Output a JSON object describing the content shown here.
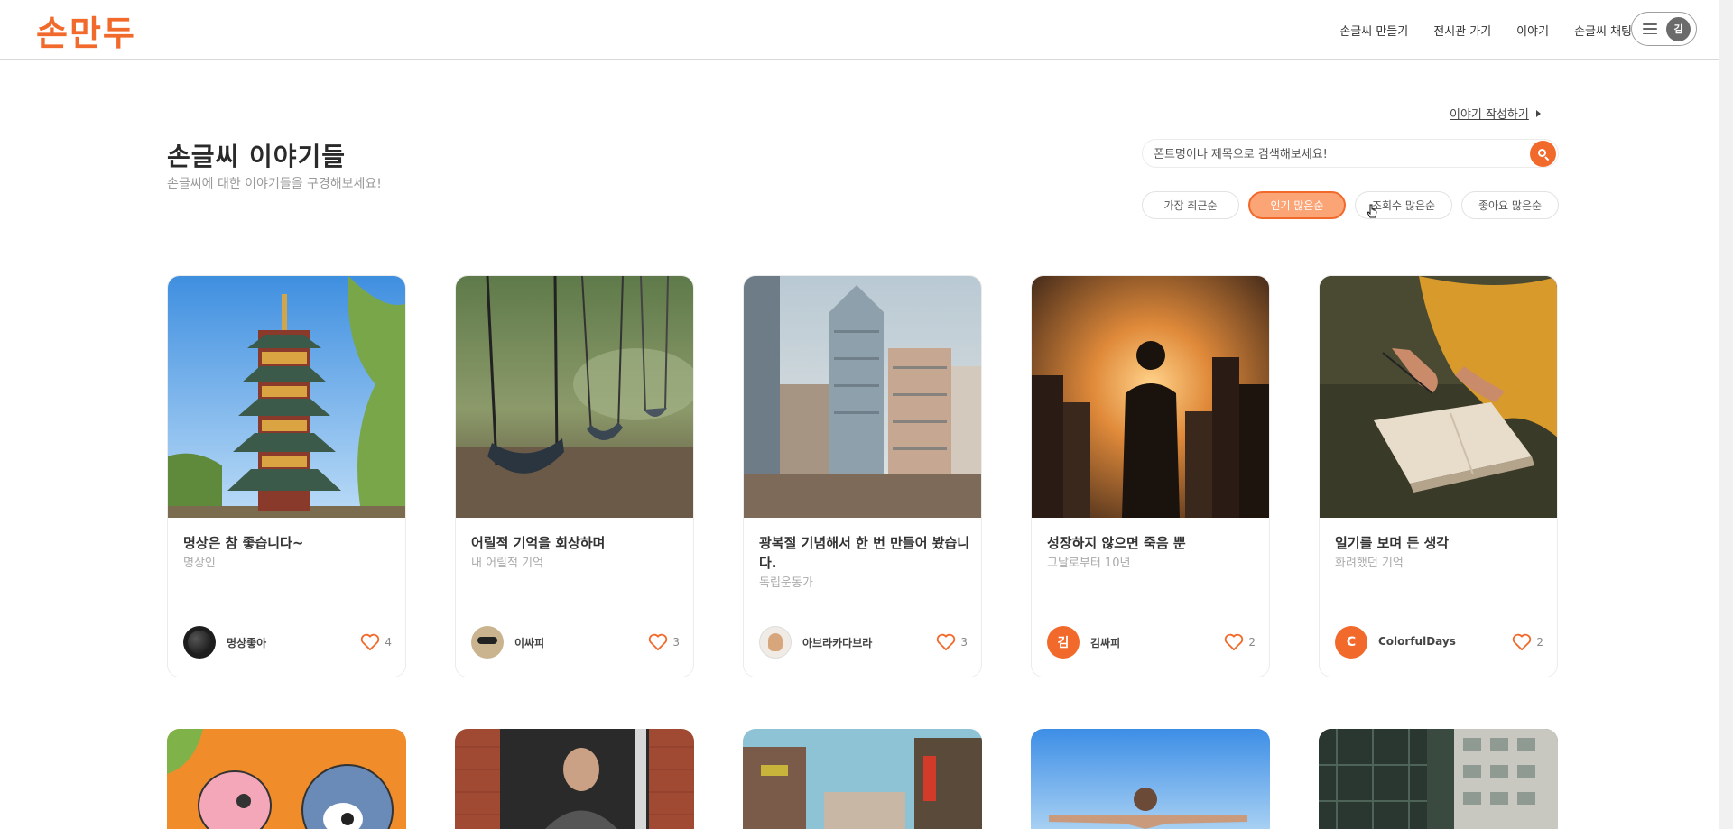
{
  "app": {
    "logo": "손만두"
  },
  "nav": {
    "items": [
      {
        "label": "손글씨 만들기"
      },
      {
        "label": "전시관 가기"
      },
      {
        "label": "이야기"
      },
      {
        "label": "손글씨 채팅"
      }
    ],
    "user_initial": "김"
  },
  "page": {
    "write_link": "이야기 작성하기",
    "title": "손글씨 이야기들",
    "subtitle": "손글씨에 대한 이야기들을 구경해보세요!"
  },
  "search": {
    "placeholder": "폰트명이나 제목으로 검색해보세요!"
  },
  "sorts": [
    {
      "label": "가장 최근순",
      "active": false
    },
    {
      "label": "인기 많은순",
      "active": true
    },
    {
      "label": "조회수 많은순",
      "active": false
    },
    {
      "label": "좋아요 많은순",
      "active": false
    }
  ],
  "cards": [
    {
      "title": "명상은 참 좋습니다~",
      "subtitle": "명상인",
      "author": "명상좋아",
      "author_initial": "",
      "likes": "4",
      "theme": "pagoda"
    },
    {
      "title": "어릴적 기억을 회상하며",
      "subtitle": "내 어릴적 기억",
      "author": "이싸피",
      "author_initial": "",
      "likes": "3",
      "theme": "swings"
    },
    {
      "title": "광복절 기념해서 한 번 만들어 봤습니다.",
      "subtitle": "독립운동가",
      "author": "아브라카다브라",
      "author_initial": "",
      "likes": "3",
      "theme": "city"
    },
    {
      "title": "성장하지 않으면 죽음 뿐",
      "subtitle": "그날로부터 10년",
      "author": "김싸피",
      "author_initial": "김",
      "likes": "2",
      "theme": "sunset"
    },
    {
      "title": "일기를 보며 든 생각",
      "subtitle": "화려했던 기억",
      "author": "ColorfulDays",
      "author_initial": "C",
      "likes": "2",
      "theme": "diary"
    }
  ],
  "colors": {
    "accent": "#f26a2b",
    "accent_soft": "#fba476"
  }
}
